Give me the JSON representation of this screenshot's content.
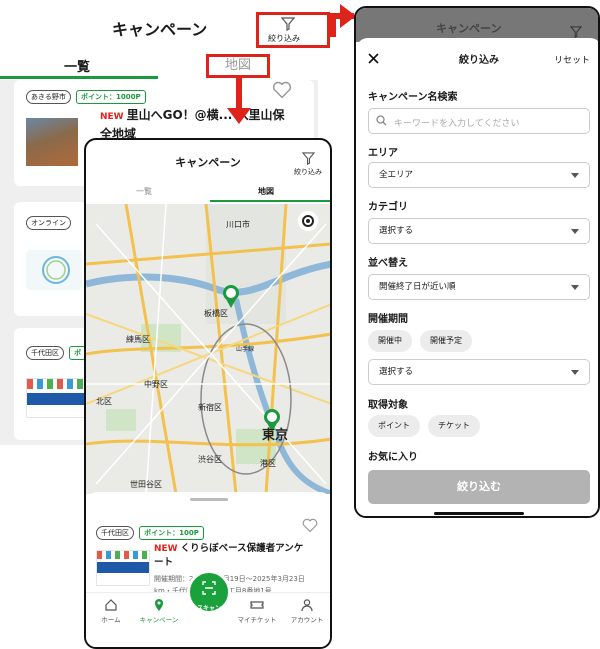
{
  "background": {
    "title": "キャンペーン",
    "filter_label": "絞り込み",
    "tab_list": "一覧",
    "tab_map": "地図",
    "cards": [
      {
        "area": "あきる野市",
        "points": "ポイント：1000P",
        "new": "NEW",
        "title": "里山へGO！@横... 入里山保全地域"
      },
      {
        "area": "オンライン"
      },
      {
        "area": "千代田区",
        "points": "ポ"
      }
    ]
  },
  "phone": {
    "title": "キャンペーン",
    "filter_label": "絞り込み",
    "tab_list": "一覧",
    "tab_map": "地図",
    "map_labels": [
      "川口市",
      "板橋区",
      "練馬区",
      "中野区",
      "新宿区",
      "渋谷区",
      "世田谷区",
      "港区",
      "東京",
      "北区",
      "山手線"
    ],
    "card": {
      "area": "千代田区",
      "points": "ポイント：100P",
      "new": "NEW",
      "title": "くりらぼベース保護者アンケート",
      "date": "開催期間：2024年12月19日〜2025年3月23日",
      "address": "km・千代田区一番町三丁目8番地1号"
    },
    "tabbar": {
      "home": "ホーム",
      "campaign": "キャンペーン",
      "scan": "スキャン",
      "ticket": "マイチケット",
      "account": "アカウント"
    }
  },
  "panel": {
    "top_title": "キャンペーン",
    "title": "絞り込み",
    "reset": "リセット",
    "name_search_label": "キャンペーン名検索",
    "search_placeholder": "キーワードを入力してください",
    "area_label": "エリア",
    "area_value": "全エリア",
    "category_label": "カテゴリ",
    "category_value": "選択する",
    "sort_label": "並べ替え",
    "sort_value": "開催終了日が近い順",
    "period_label": "開催期間",
    "period_chip_1": "開催中",
    "period_chip_2": "開催予定",
    "period_value": "選択する",
    "target_label": "取得対象",
    "target_chip_1": "ポイント",
    "target_chip_2": "チケット",
    "favorite_label": "お気に入り",
    "submit": "絞り込む"
  },
  "colors": {
    "accent_green": "#1a9a3c",
    "annotation_red": "#e0231a"
  }
}
